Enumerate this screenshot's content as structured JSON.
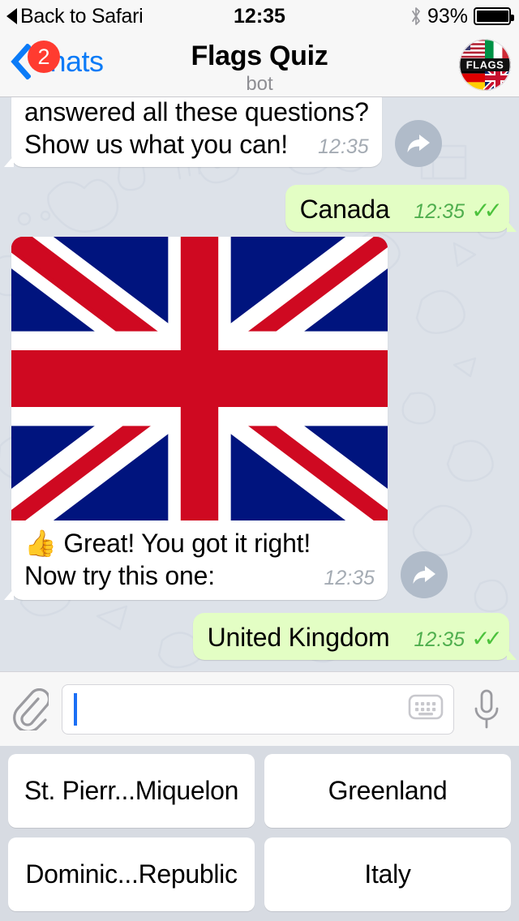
{
  "status_bar": {
    "back_label": "Back to Safari",
    "time": "12:35",
    "battery_percent": "93%",
    "battery_level": 93,
    "bluetooth_icon": "bluetooth-icon"
  },
  "nav": {
    "back_label": "Chats",
    "back_badge": "2",
    "title": "Flags Quiz",
    "subtitle": "bot",
    "avatar_label": "FLAGS",
    "accent_color": "#0b7bf7",
    "badge_color": "#ff3b30"
  },
  "chat": {
    "background_color": "#dde2e9",
    "messages": [
      {
        "id": "msg-intro",
        "direction": "in",
        "line1": "answered all these questions?",
        "line2": "Show us what you can!",
        "time": "12:35",
        "forward_icon": "forward-arrow-icon"
      },
      {
        "id": "msg-canada",
        "direction": "out",
        "text": "Canada",
        "time": "12:35",
        "ticks": "✓✓"
      },
      {
        "id": "msg-flag-photo",
        "direction": "in",
        "photo_alt": "united-kingdom-flag",
        "caption_line1": "👍 Great! You got it right!",
        "caption_line2": "Now try this one:",
        "time": "12:35",
        "forward_icon": "forward-arrow-icon"
      },
      {
        "id": "msg-uk",
        "direction": "out",
        "text": "United Kingdom",
        "time": "12:35",
        "ticks": "✓✓"
      }
    ]
  },
  "input_bar": {
    "attach_icon": "paperclip-icon",
    "value": "",
    "placeholder": "",
    "keyboard_icon": "keyboard-icon",
    "mic_icon": "microphone-icon"
  },
  "reply_keyboard": {
    "rows": [
      [
        {
          "label": "St. Pierr...Miquelon"
        },
        {
          "label": "Greenland"
        }
      ],
      [
        {
          "label": "Dominic...Republic"
        },
        {
          "label": "Italy"
        }
      ]
    ]
  }
}
